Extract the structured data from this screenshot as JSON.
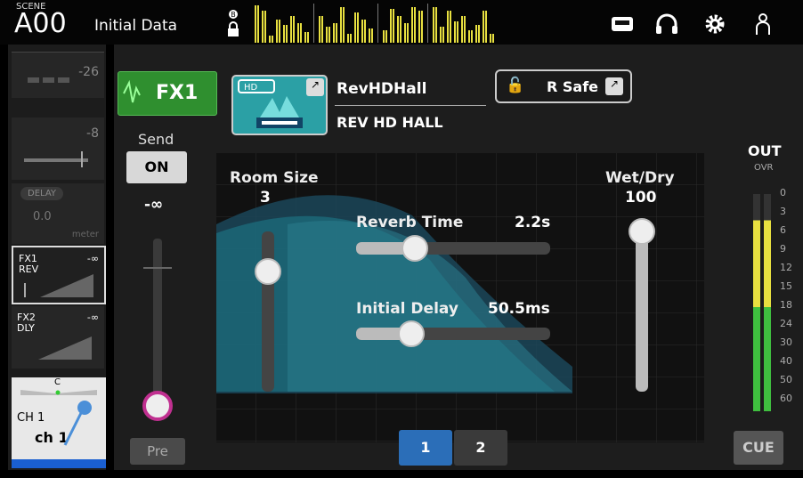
{
  "scene": {
    "label": "SCENE",
    "number": "A00",
    "name": "Initial Data"
  },
  "header_icons": [
    "tape-recorder-icon",
    "headphones-icon",
    "gear-icon",
    "user-icon"
  ],
  "strip": {
    "gain_value": "-26",
    "att_value": "-8",
    "delay_label": "DELAY",
    "delay_value": "0.0",
    "delay_unit": "meter",
    "sends": [
      {
        "name": "FX1",
        "type": "REV",
        "level": "-∞",
        "selected": true
      },
      {
        "name": "FX2",
        "type": "DLY",
        "level": "-∞",
        "selected": false
      }
    ],
    "pan_label": "C",
    "channel_label": "CH 1",
    "channel_name": "ch 1",
    "channel_color": "#1a5fd0"
  },
  "fx": {
    "label": "FX1",
    "send_label": "Send",
    "send_on": "ON",
    "send_level": "-∞",
    "pre_label": "Pre",
    "send_fader_level": 0.0
  },
  "effect": {
    "title": "RevHDHall",
    "type": "REV HD HALL",
    "rsafe_label": "R Safe"
  },
  "params": {
    "room_size": {
      "label": "Room Size",
      "value": "3",
      "level": 0.8
    },
    "reverb_time": {
      "label": "Reverb Time",
      "value": "2.2s",
      "level": 0.27
    },
    "initial_delay": {
      "label": "Initial Delay",
      "value": "50.5ms",
      "level": 0.25
    },
    "wet_dry": {
      "label": "Wet/Dry",
      "value": "100",
      "level": 1.0
    }
  },
  "out": {
    "label": "OUT",
    "ovr_label": "OVR",
    "scale": [
      "0",
      "3",
      "6",
      "9",
      "12",
      "15",
      "18",
      "24",
      "30",
      "40",
      "50",
      "60"
    ]
  },
  "pages": {
    "items": [
      "1",
      "2"
    ],
    "selected": "1"
  },
  "cue_label": "CUE",
  "colors": {
    "accent_green": "#2f8f2f",
    "page_selected": "#2b6eb8",
    "meter_green": "#3fbf3f",
    "meter_yellow": "#e8e040"
  }
}
